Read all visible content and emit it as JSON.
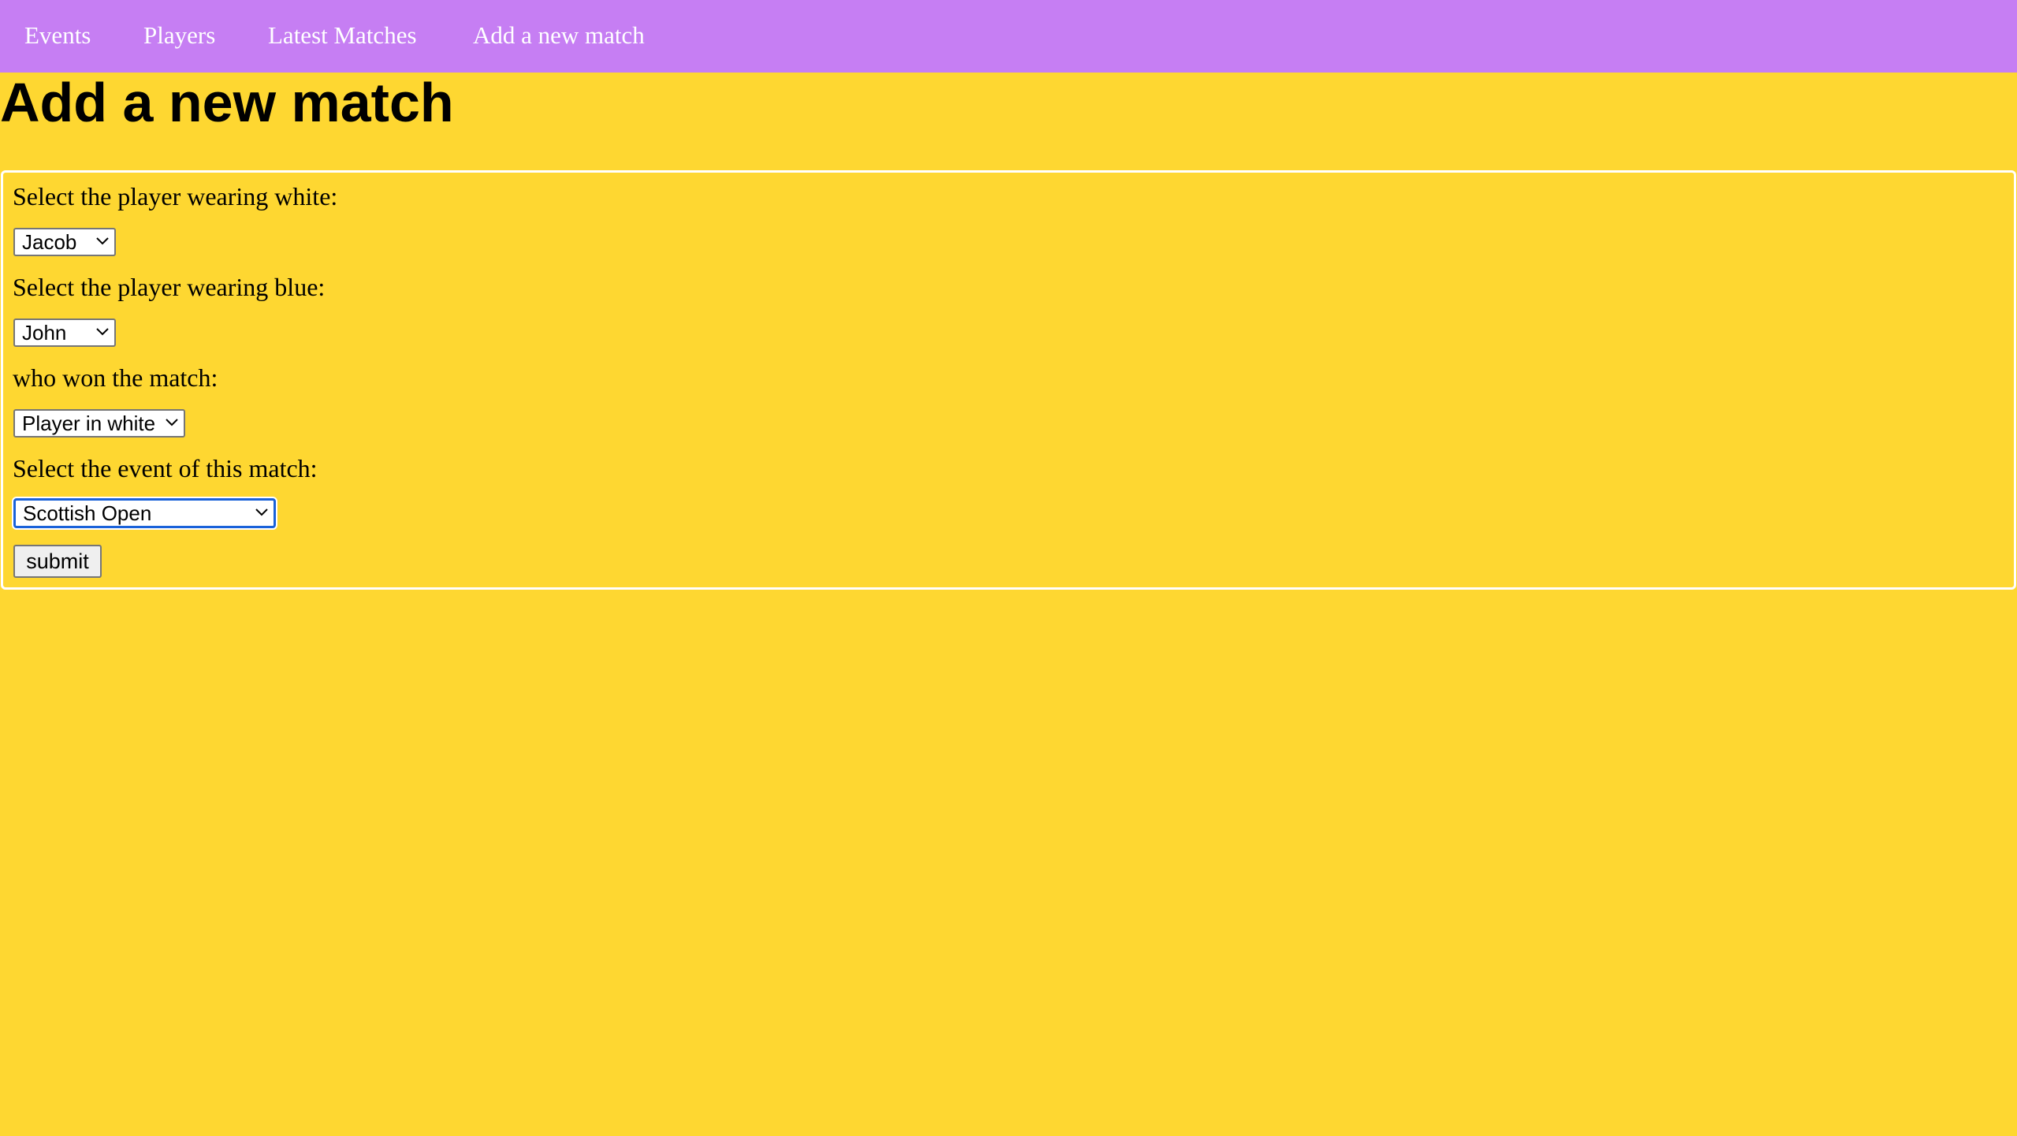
{
  "nav": {
    "items": [
      {
        "label": "Events"
      },
      {
        "label": "Players"
      },
      {
        "label": "Latest Matches"
      },
      {
        "label": "Add a new match"
      }
    ]
  },
  "page": {
    "title": "Add a new match"
  },
  "form": {
    "white_player": {
      "label": "Select the player wearing white:",
      "selected": "Jacob"
    },
    "blue_player": {
      "label": "Select the player wearing blue:",
      "selected": "John"
    },
    "winner": {
      "label": "who won the match:",
      "selected": "Player in white"
    },
    "event": {
      "label": "Select the event of this match:",
      "selected": "Scottish Open"
    },
    "submit_label": "submit"
  },
  "colors": {
    "nav_background": "#c67ef3",
    "page_background": "#fed731",
    "focus_ring": "#1a62d9"
  },
  "icons": {
    "dropdown": "chevron-down-icon"
  }
}
